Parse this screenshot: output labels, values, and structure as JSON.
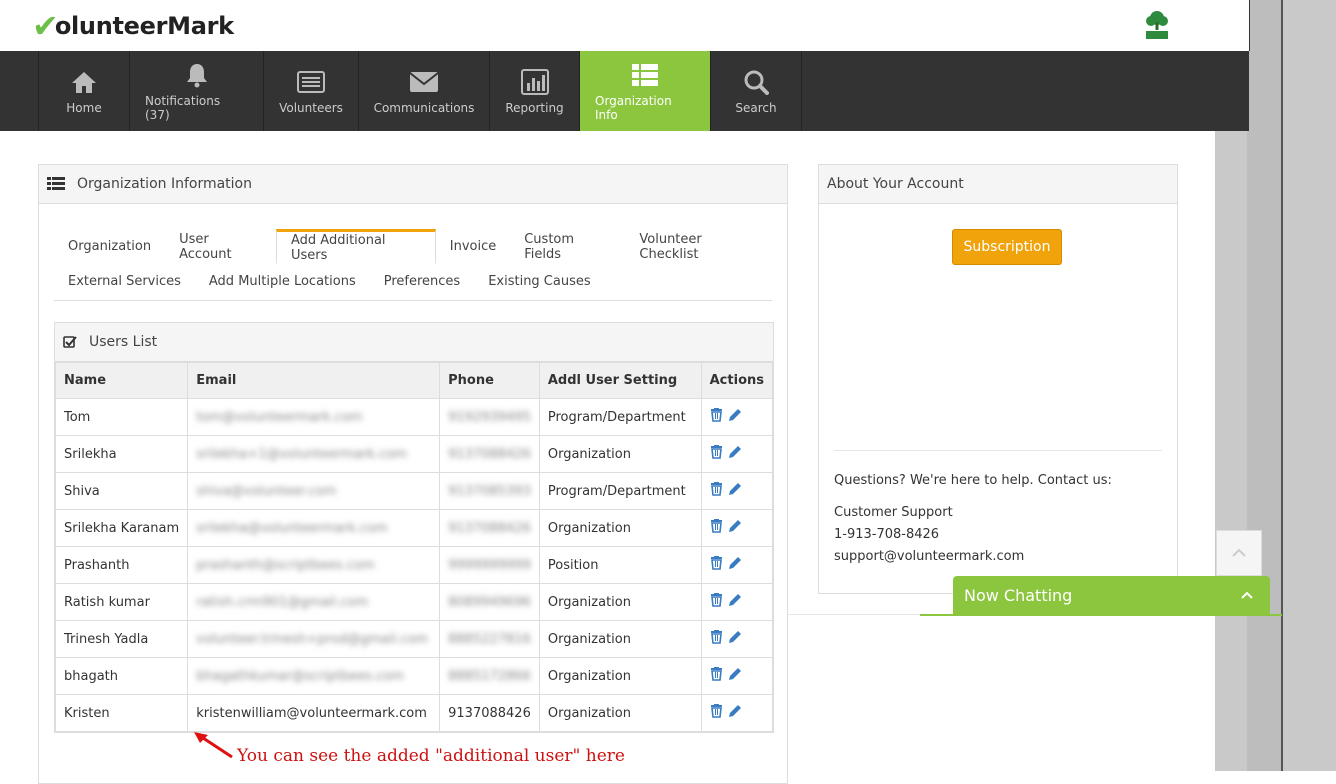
{
  "brand": {
    "logo_text": "olunteerMark",
    "logo_check": "✔"
  },
  "nav": [
    {
      "label": "Home",
      "icon": "home-icon"
    },
    {
      "label": "Notifications  (37)",
      "icon": "bell-icon"
    },
    {
      "label": "Volunteers",
      "icon": "list-icon"
    },
    {
      "label": "Communications",
      "icon": "envelope-icon"
    },
    {
      "label": "Reporting",
      "icon": "bar-chart-icon"
    },
    {
      "label": "Organization Info",
      "icon": "grid-list-icon",
      "active": true
    },
    {
      "label": "Search",
      "icon": "search-icon"
    }
  ],
  "main_panel": {
    "title": "Organization Information",
    "tabs_row1": [
      "Organization",
      "User Account",
      "Add Additional Users",
      "Invoice",
      "Custom Fields",
      "Volunteer Checklist"
    ],
    "tabs_row2": [
      "External Services",
      "Add Multiple Locations",
      "Preferences",
      "Existing Causes"
    ],
    "active_tab": "Add Additional Users"
  },
  "users_list": {
    "title": "Users List",
    "columns": [
      "Name",
      "Email",
      "Phone",
      "Addl User Setting",
      "Actions"
    ],
    "rows": [
      {
        "name": "Tom",
        "email": "tom@volunteermark.com",
        "phone": "9192939495",
        "setting": "Program/Department",
        "blurred": true
      },
      {
        "name": "Srilekha",
        "email": "srilekha+1@volunteermark.com",
        "phone": "9137088426",
        "setting": "Organization",
        "blurred": true
      },
      {
        "name": "Shiva",
        "email": "shiva@volunteer.com",
        "phone": "9137085393",
        "setting": "Program/Department",
        "blurred": true
      },
      {
        "name": "Srilekha Karanam",
        "email": "srilekha@volunteermark.com",
        "phone": "9137088426",
        "setting": "Organization",
        "blurred": true
      },
      {
        "name": "Prashanth",
        "email": "prashanth@scriptbees.com",
        "phone": "9999999999",
        "setting": "Position",
        "blurred": true
      },
      {
        "name": "Ratish kumar",
        "email": "ratish.crm901@gmail.com",
        "phone": "8089949696",
        "setting": "Organization",
        "blurred": true
      },
      {
        "name": "Trinesh Yadla",
        "email": "volunteer.trinesh+prod@gmail.com",
        "phone": "8885227816",
        "setting": "Organization",
        "blurred": true
      },
      {
        "name": "bhagath",
        "email": "bhagathkumar@scriptbees.com",
        "phone": "8885172866",
        "setting": "Organization",
        "blurred": true
      },
      {
        "name": "Kristen",
        "email": "kristenwilliam@volunteermark.com",
        "phone": "9137088426",
        "setting": "Organization",
        "blurred": false
      }
    ]
  },
  "side_panel": {
    "title": "About Your Account",
    "subscription_label": "Subscription",
    "help_text": "Questions? We're here to help. Contact us:",
    "support_label": "Customer Support",
    "support_phone": "1-913-708-8426",
    "support_email": "support@volunteermark.com"
  },
  "chat": {
    "label": "Now Chatting"
  },
  "annotation": "You can see the added \"additional user\" here",
  "colors": {
    "nav_bg": "#333333",
    "active_green": "#8cc63f",
    "subscription_orange": "#f0a30a",
    "annotation_red": "#cc1111",
    "icon_blue": "#3a7cc2"
  }
}
